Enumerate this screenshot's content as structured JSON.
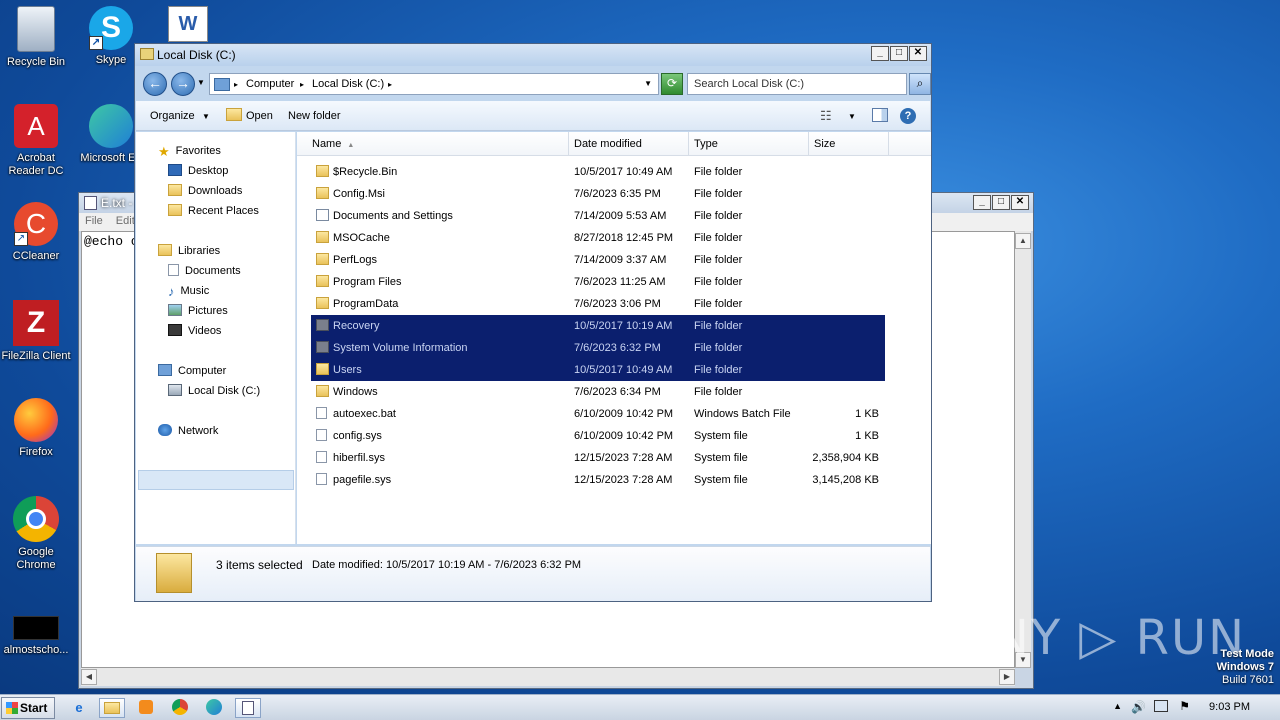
{
  "desktop": {
    "icons": [
      {
        "name": "recycle-bin",
        "label": "Recycle Bin",
        "glyph": "🗑"
      },
      {
        "name": "skype",
        "label": "Skype",
        "glyph": "S"
      },
      {
        "name": "word-doc",
        "label": "",
        "glyph": "W"
      },
      {
        "name": "acrobat",
        "label": "Acrobat Reader DC",
        "glyph": "A"
      },
      {
        "name": "edge",
        "label": "Microsoft Ed",
        "glyph": "e"
      },
      {
        "name": "ccleaner",
        "label": "CCleaner",
        "glyph": "C"
      },
      {
        "name": "filezilla",
        "label": "FileZilla Client",
        "glyph": "Z"
      },
      {
        "name": "firefox",
        "label": "Firefox",
        "glyph": "ff"
      },
      {
        "name": "chrome",
        "label": "Google Chrome",
        "glyph": "◉"
      },
      {
        "name": "almostscho",
        "label": "almostscho...",
        "glyph": ""
      }
    ],
    "watermark": "ANY ▷ RUN",
    "testmode": {
      "line1": "Test Mode",
      "line2": "Windows 7",
      "line3": "Build 7601"
    }
  },
  "notepad": {
    "title": "E.txt -",
    "menu": [
      "File",
      "Edit"
    ],
    "text": "@echo o"
  },
  "explorer": {
    "title": "Local Disk (C:)",
    "address": {
      "crumb1": "Computer",
      "crumb2": "Local Disk (C:)"
    },
    "search_placeholder": "Search Local Disk (C:)",
    "toolbar": {
      "organize": "Organize",
      "open": "Open",
      "new_folder": "New folder"
    },
    "nav": {
      "favorites": "Favorites",
      "desktop": "Desktop",
      "downloads": "Downloads",
      "recent": "Recent Places",
      "libraries": "Libraries",
      "documents": "Documents",
      "music": "Music",
      "pictures": "Pictures",
      "videos": "Videos",
      "computer": "Computer",
      "localdisk": "Local Disk (C:)",
      "network": "Network"
    },
    "columns": {
      "name": "Name",
      "date": "Date modified",
      "type": "Type",
      "size": "Size"
    },
    "files": [
      {
        "name": "$Recycle.Bin",
        "date": "10/5/2017 10:49 AM",
        "type": "File folder",
        "size": "",
        "kind": "fold",
        "selected": false
      },
      {
        "name": "Config.Msi",
        "date": "7/6/2023 6:35 PM",
        "type": "File folder",
        "size": "",
        "kind": "fold",
        "selected": false
      },
      {
        "name": "Documents and Settings",
        "date": "7/14/2009 5:53 AM",
        "type": "File folder",
        "size": "",
        "kind": "lnk",
        "selected": false
      },
      {
        "name": "MSOCache",
        "date": "8/27/2018 12:45 PM",
        "type": "File folder",
        "size": "",
        "kind": "fold",
        "selected": false
      },
      {
        "name": "PerfLogs",
        "date": "7/14/2009 3:37 AM",
        "type": "File folder",
        "size": "",
        "kind": "fold",
        "selected": false
      },
      {
        "name": "Program Files",
        "date": "7/6/2023 11:25 AM",
        "type": "File folder",
        "size": "",
        "kind": "fold",
        "selected": false
      },
      {
        "name": "ProgramData",
        "date": "7/6/2023 3:06 PM",
        "type": "File folder",
        "size": "",
        "kind": "fold",
        "selected": false
      },
      {
        "name": "Recovery",
        "date": "10/5/2017 10:19 AM",
        "type": "File folder",
        "size": "",
        "kind": "fold-sys",
        "selected": true
      },
      {
        "name": "System Volume Information",
        "date": "7/6/2023 6:32 PM",
        "type": "File folder",
        "size": "",
        "kind": "fold-sys",
        "selected": true
      },
      {
        "name": "Users",
        "date": "10/5/2017 10:49 AM",
        "type": "File folder",
        "size": "",
        "kind": "fold",
        "selected": true
      },
      {
        "name": "Windows",
        "date": "7/6/2023 6:34 PM",
        "type": "File folder",
        "size": "",
        "kind": "fold",
        "selected": false
      },
      {
        "name": "autoexec.bat",
        "date": "6/10/2009 10:42 PM",
        "type": "Windows Batch File",
        "size": "1 KB",
        "kind": "file",
        "selected": false
      },
      {
        "name": "config.sys",
        "date": "6/10/2009 10:42 PM",
        "type": "System file",
        "size": "1 KB",
        "kind": "file",
        "selected": false
      },
      {
        "name": "hiberfil.sys",
        "date": "12/15/2023 7:28 AM",
        "type": "System file",
        "size": "2,358,904 KB",
        "kind": "file",
        "selected": false
      },
      {
        "name": "pagefile.sys",
        "date": "12/15/2023 7:28 AM",
        "type": "System file",
        "size": "3,145,208 KB",
        "kind": "file",
        "selected": false
      }
    ],
    "details": {
      "count": "3 items selected",
      "date_modified": "Date modified: 10/5/2017 10:19 AM - 7/6/2023 6:32 PM"
    }
  },
  "taskbar": {
    "start": "Start",
    "clock": "9:03 PM"
  }
}
